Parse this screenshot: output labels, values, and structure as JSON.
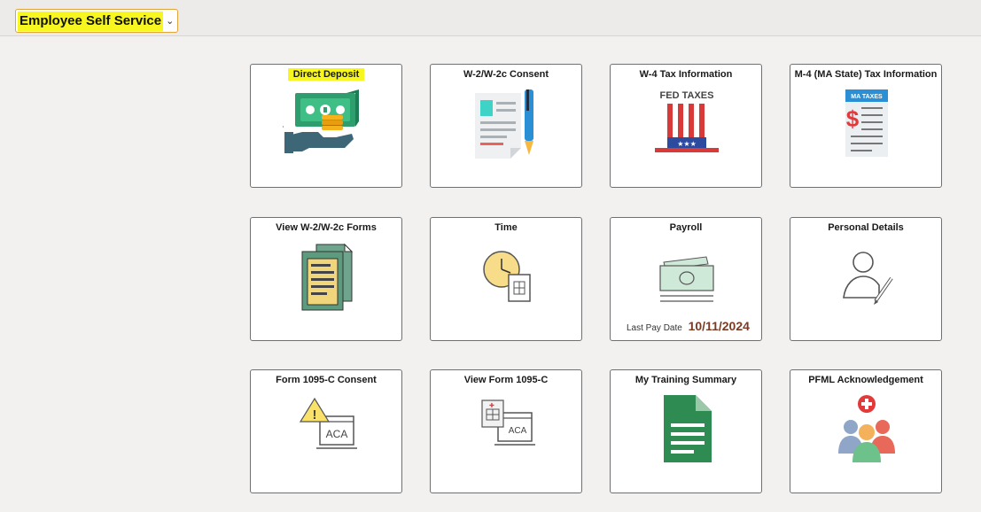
{
  "header": {
    "homepage_label": "Employee Self Service",
    "chevron": "chevron-down-icon"
  },
  "tiles": [
    {
      "title": "Direct Deposit",
      "icon": "money-hand-icon"
    },
    {
      "title": "W-2/W-2c Consent",
      "icon": "document-pen-icon"
    },
    {
      "title": "W-4 Tax Information",
      "icon": "fed-taxes-hat-icon",
      "icon_text": "FED TAXES"
    },
    {
      "title": "M-4 (MA State) Tax Information",
      "icon": "ma-taxes-document-icon",
      "icon_text": "MA TAXES"
    },
    {
      "title": "View W-2/W-2c Forms",
      "icon": "forms-stack-icon"
    },
    {
      "title": "Time",
      "icon": "clock-timesheet-icon"
    },
    {
      "title": "Payroll",
      "icon": "paycheck-icon",
      "last_pay_label": "Last Pay Date",
      "last_pay_date": "10/11/2024"
    },
    {
      "title": "Personal Details",
      "icon": "user-edit-icon"
    },
    {
      "title": "Form 1095-C Consent",
      "icon": "warning-aca-icon",
      "icon_text": "ACA"
    },
    {
      "title": "View Form 1095-C",
      "icon": "aca-document-icon",
      "icon_text": "ACA"
    },
    {
      "title": "My Training Summary",
      "icon": "green-document-icon"
    },
    {
      "title": "PFML Acknowledgement",
      "icon": "people-medical-icon"
    }
  ],
  "colors": {
    "highlight": "#f7f71f",
    "pay_date": "#7a3b25",
    "tile_border": "#707070"
  }
}
